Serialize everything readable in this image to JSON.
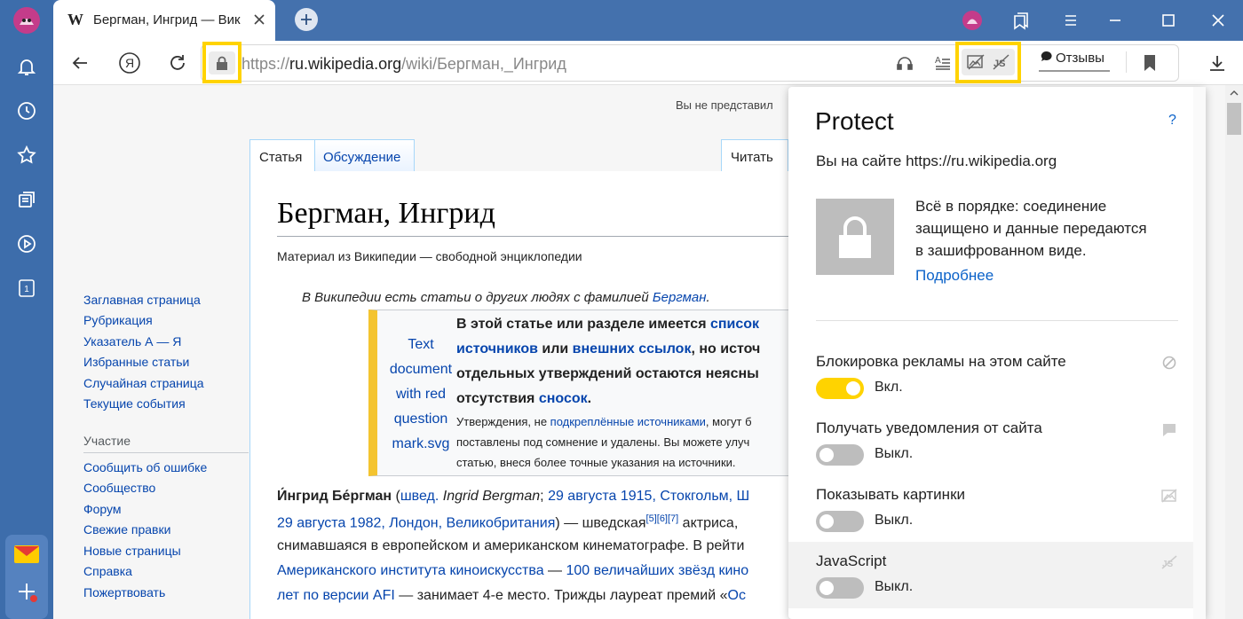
{
  "tab": {
    "favicon": "W",
    "title": "Бергман, Ингрид — Вик"
  },
  "address": {
    "scheme": "https://",
    "host": "ru.wikipedia.org",
    "path": "/wiki/Бергман,_Ингрид"
  },
  "toolbar": {
    "reviews_label": "Отзывы"
  },
  "wiki": {
    "top_right": "Вы не представил",
    "tabs": {
      "article": "Статья",
      "discussion": "Обсуждение",
      "read": "Читать"
    },
    "title": "Бергман, Ингрид",
    "from": "Материал из Википедии — свободной энциклопедии",
    "hatnote_prefix": "В Википедии есть статьи о других людях с фамилией ",
    "hatnote_link": "Бергман",
    "hatnote_suffix": ".",
    "sidebar": {
      "nav": [
        "Заглавная страница",
        "Рубрикация",
        "Указатель А — Я",
        "Избранные статьи",
        "Случайная страница",
        "Текущие события"
      ],
      "participation_heading": "Участие",
      "participation": [
        "Сообщить об ошибке",
        "Сообщество",
        "Форум",
        "Свежие правки",
        "Новые страницы",
        "Справка",
        "Пожертвовать"
      ]
    },
    "notice": {
      "image_alt": [
        "Text",
        "document",
        "with red",
        "question",
        "mark.svg"
      ],
      "line1_a": "В этой статье или разделе имеется ",
      "line1_link": "список",
      "line2_link_a": "источников",
      "line2_mid": " или ",
      "line2_link_b": "внешних ссылок",
      "line2_tail": ", но источ",
      "line3": "отдельных утверждений остаются неясны",
      "line4_a": "отсутствия ",
      "line4_link": "сносок",
      "line4_b": ".",
      "small1_a": "Утверждения, не ",
      "small1_link": "подкреплённые источниками",
      "small1_b": ", могут б",
      "small2": "поставлены под сомнение и удалены. Вы можете улуч",
      "small3": "статью, внеся более точные указания на источники."
    },
    "body": {
      "l1_name": "И́нгрид Бе́ргман",
      "l1_a": " (",
      "l1_swed": "швед.",
      "l1_b": " ",
      "l1_orig": "Ingrid Bergman",
      "l1_c": "; ",
      "l1_date": "29 августа 1915",
      "l1_d": ", ",
      "l1_city": "Стокгольм",
      "l1_e": ", Ш",
      "l2_date": "29 августа 1982",
      "l2_a": ", ",
      "l2_city": "Лондон",
      "l2_b": ", ",
      "l2_country": "Великобритания",
      "l2_c": ") — шведская",
      "l2_refs": "[5][6][7]",
      "l2_d": " актриса,",
      "l3": "снимавшаяся в европейском и американском кинематографе. В рейти",
      "l4_link": "Американского института киноискусства",
      "l4_mid": " — ",
      "l4_link2": "100 величайших звёзд кино",
      "l5_link": "лет по версии AFI",
      "l5_a": " — занимает 4-е место. Трижды лауреат премий «",
      "l5_link2": "Ос"
    }
  },
  "protect": {
    "title": "Protect",
    "help": "?",
    "site_line": "Вы на сайте https://ru.wikipedia.org",
    "status_lines": [
      "Всё в порядке: соединение",
      "защищено и данные передаются",
      "в зашифрованном виде."
    ],
    "details_link": "Подробнее",
    "settings": [
      {
        "label": "Блокировка рекламы на этом сайте",
        "state": "Вкл.",
        "on": true,
        "icon": "block-icon"
      },
      {
        "label": "Получать уведомления от сайта",
        "state": "Выкл.",
        "on": false,
        "icon": "notification-icon"
      },
      {
        "label": "Показывать картинки",
        "state": "Выкл.",
        "on": false,
        "icon": "image-icon"
      },
      {
        "label": "JavaScript",
        "state": "Выкл.",
        "on": false,
        "icon": "js-icon"
      }
    ]
  },
  "colors": {
    "accent_yellow": "#ffd300",
    "toggle_off": "#bdbdbd",
    "link": "#0645ad",
    "rail": "#3d6dab"
  }
}
